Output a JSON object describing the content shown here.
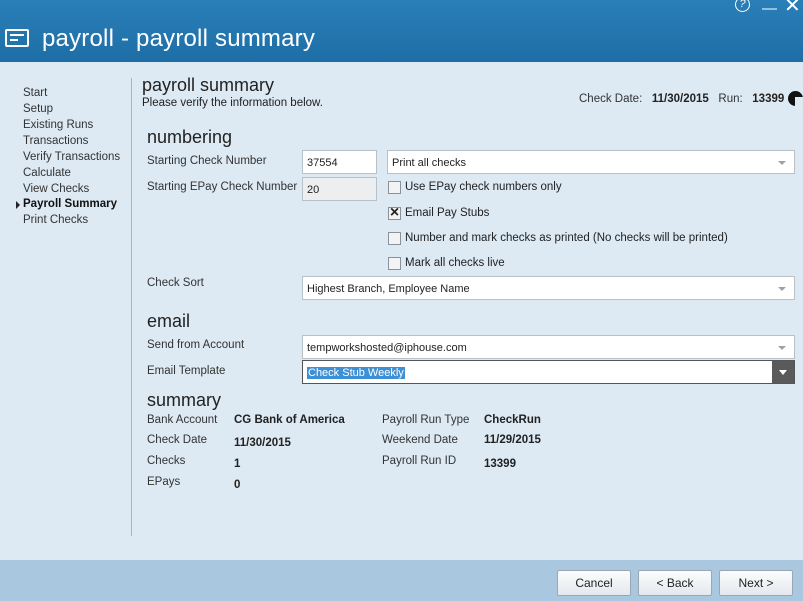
{
  "window": {
    "title": "payroll - payroll summary",
    "help_glyph": "?",
    "minimize_glyph": "—",
    "close_glyph": "✕"
  },
  "sidebar": {
    "items": [
      {
        "label": "Start",
        "active": false
      },
      {
        "label": "Setup",
        "active": false
      },
      {
        "label": "Existing Runs",
        "active": false
      },
      {
        "label": "Transactions",
        "active": false
      },
      {
        "label": "Verify Transactions",
        "active": false
      },
      {
        "label": "Calculate",
        "active": false
      },
      {
        "label": "View Checks",
        "active": false
      },
      {
        "label": "Payroll Summary",
        "active": true
      },
      {
        "label": "Print Checks",
        "active": false
      }
    ]
  },
  "header": {
    "title": "payroll summary",
    "subtitle": "Please verify the information below.",
    "check_date_label": "Check Date:",
    "check_date_value": "11/30/2015",
    "run_label": "Run:",
    "run_value": "13399"
  },
  "numbering": {
    "heading": "numbering",
    "starting_check_label": "Starting Check Number",
    "starting_check_value": "37554",
    "print_option_value": "Print all checks",
    "starting_epay_label": "Starting EPay Check Number",
    "starting_epay_value": "20",
    "use_epay_only_label": "Use EPay check numbers only",
    "use_epay_only_checked": false,
    "email_stubs_label": "Email Pay Stubs",
    "email_stubs_checked": true,
    "number_mark_label": "Number and mark checks as printed (No checks will be printed)",
    "number_mark_checked": false,
    "mark_live_label": "Mark all checks live",
    "mark_live_checked": false,
    "check_sort_label": "Check Sort",
    "check_sort_value": "Highest Branch, Employee Name"
  },
  "email": {
    "heading": "email",
    "send_from_label": "Send from Account",
    "send_from_value": "tempworkshosted@iphouse.com",
    "template_label": "Email Template",
    "template_value": "Check Stub Weekly"
  },
  "summary": {
    "heading": "summary",
    "bank_account_label": "Bank Account",
    "bank_account_value": "CG Bank of America",
    "check_date_label": "Check Date",
    "check_date_value": "11/30/2015",
    "checks_label": "Checks",
    "checks_value": "1",
    "epays_label": "EPays",
    "epays_value": "0",
    "run_type_label": "Payroll Run Type",
    "run_type_value": "CheckRun",
    "weekend_date_label": "Weekend Date",
    "weekend_date_value": "11/29/2015",
    "run_id_label": "Payroll Run ID",
    "run_id_value": "13399"
  },
  "footer": {
    "cancel_label": "Cancel",
    "back_label": "< Back",
    "next_label": "Next >"
  },
  "colors": {
    "titlebar": "#1e6ea6",
    "background": "#dde9f3",
    "footer": "#a9c8e0",
    "selection": "#3d8fd6"
  }
}
